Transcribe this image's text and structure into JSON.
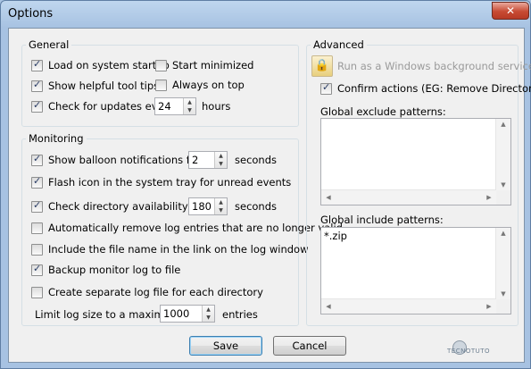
{
  "window": {
    "title": "Options",
    "close_glyph": "✕"
  },
  "general": {
    "legend": "General",
    "load_on_startup": {
      "label": "Load on system startup",
      "checked": true
    },
    "start_minimized": {
      "label": "Start minimized",
      "checked": false
    },
    "show_tool_tips": {
      "label": "Show helpful tool tips",
      "checked": true
    },
    "always_on_top": {
      "label": "Always on top",
      "checked": false
    },
    "check_updates": {
      "label": "Check for updates every",
      "checked": true,
      "value": "24",
      "unit": "hours"
    }
  },
  "monitoring": {
    "legend": "Monitoring",
    "balloon": {
      "label": "Show balloon notifications for",
      "checked": true,
      "value": "2",
      "unit": "seconds"
    },
    "flash_icon": {
      "label": "Flash icon in the system tray for unread events",
      "checked": true
    },
    "check_dir": {
      "label": "Check directory availability every",
      "checked": true,
      "value": "180",
      "unit": "seconds"
    },
    "auto_remove": {
      "label": "Automatically remove log entries that are no longer valid",
      "checked": false
    },
    "include_filename": {
      "label": "Include the file name in the link on the log window",
      "checked": false
    },
    "backup_log": {
      "label": "Backup monitor log to file",
      "checked": true
    },
    "separate_log": {
      "label": "Create separate log file for each directory",
      "checked": false
    },
    "limit_log": {
      "label": "Limit log size to a maximum of",
      "value": "1000",
      "unit": "entries"
    }
  },
  "advanced": {
    "legend": "Advanced",
    "run_as_service": {
      "label": "Run as a Windows background service",
      "icon": "lock-icon"
    },
    "confirm_actions": {
      "label": "Confirm actions (EG: Remove Directory)",
      "checked": true
    },
    "exclude_label": "Global exclude patterns:",
    "exclude_value": "",
    "include_label": "Global include patterns:",
    "include_value": "*.zip"
  },
  "buttons": {
    "save": "Save",
    "cancel": "Cancel"
  },
  "watermark": "TECNOTUTO"
}
